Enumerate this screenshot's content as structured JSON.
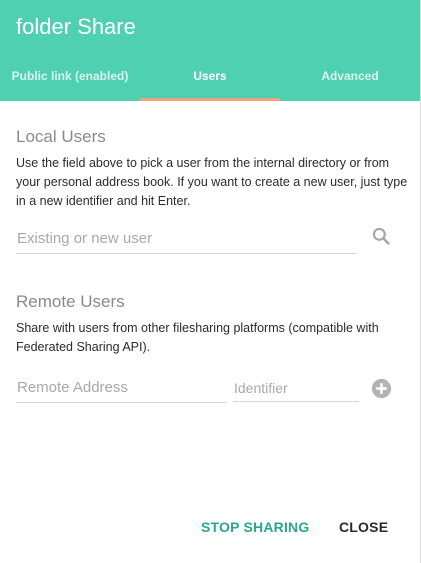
{
  "dialog": {
    "title": "folder Share",
    "tabs": [
      {
        "label": "Public link (enabled)",
        "active": false
      },
      {
        "label": "Users",
        "active": true
      },
      {
        "label": "Advanced",
        "active": false
      }
    ]
  },
  "local_users": {
    "heading": "Local Users",
    "description": "Use the field above to pick a user from the internal directory or from your personal address book. If you want to create a new user, just type in a new identifier and hit Enter.",
    "input_placeholder": "Existing or new user",
    "input_value": "",
    "search_icon": "search-icon"
  },
  "remote_users": {
    "heading": "Remote Users",
    "description": "Share with users from other filesharing platforms (compatible with Federated Sharing API).",
    "address_placeholder": "Remote Address",
    "identifier_placeholder": "Identifier",
    "add_icon": "add-circle-icon"
  },
  "actions": {
    "stop_sharing_label": "STOP SHARING",
    "close_label": "CLOSE"
  },
  "colors": {
    "header_bg": "#4fd0b0",
    "tab_indicator": "#e9a37f",
    "primary_button": "#27a88c"
  }
}
